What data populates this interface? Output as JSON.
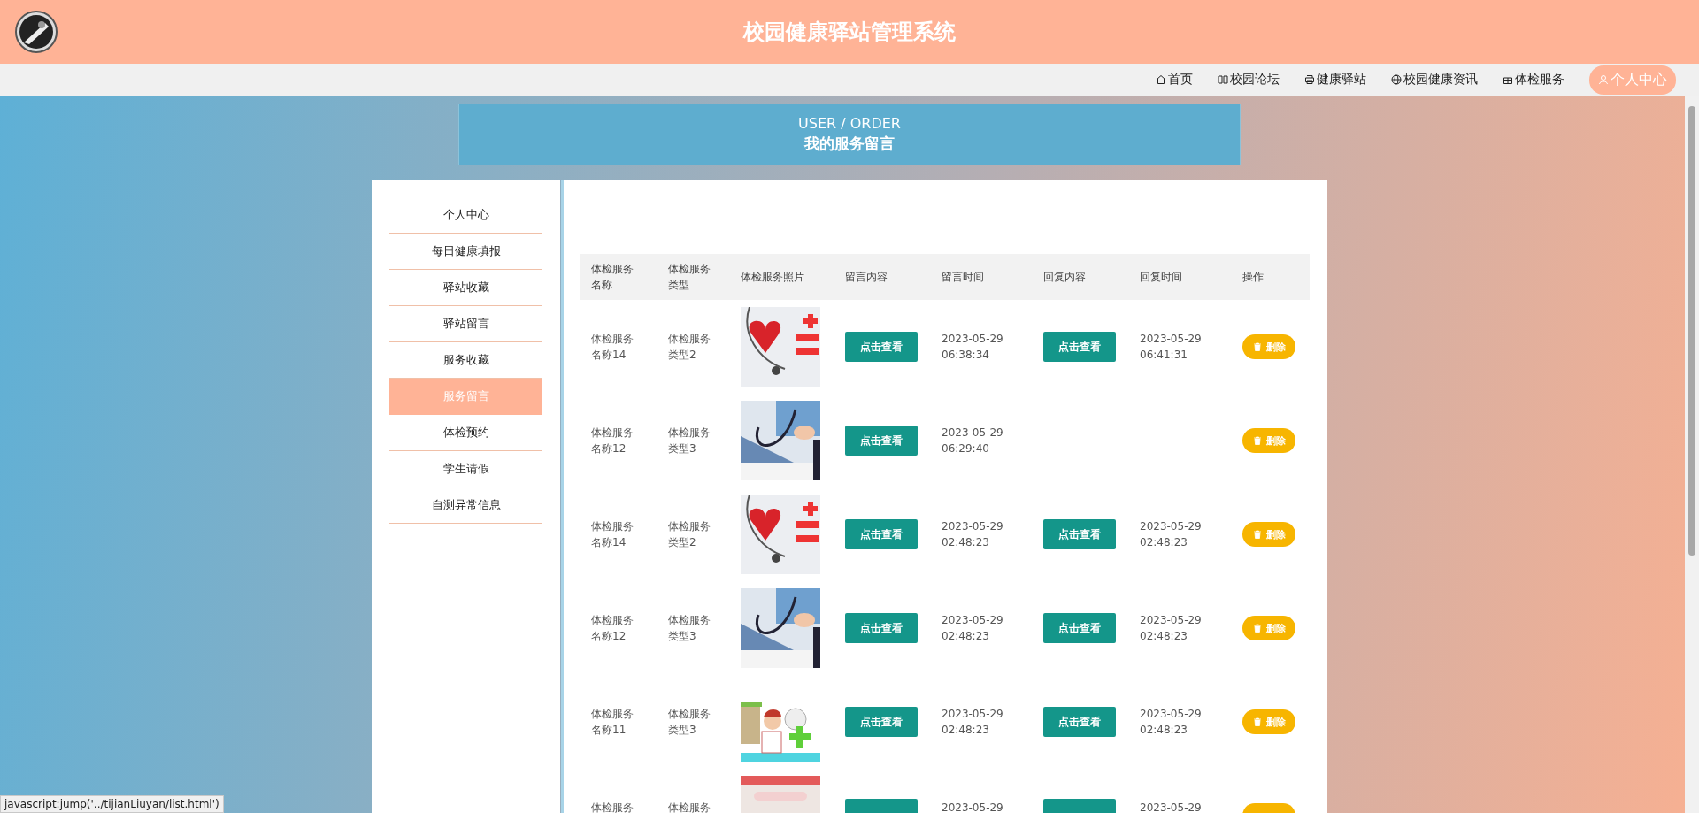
{
  "header": {
    "title": "校园健康驿站管理系统"
  },
  "nav": [
    {
      "label": "首页",
      "selected": false
    },
    {
      "label": "校园论坛",
      "selected": false
    },
    {
      "label": "健康驿站",
      "selected": false
    },
    {
      "label": "校园健康资讯",
      "selected": false
    },
    {
      "label": "体检服务",
      "selected": false
    },
    {
      "label": "个人中心",
      "selected": true
    }
  ],
  "banner": {
    "subtitle": "USER / ORDER",
    "title": "我的服务留言"
  },
  "sidebar": {
    "items": [
      {
        "label": "个人中心",
        "selected": false
      },
      {
        "label": "每日健康填报",
        "selected": false
      },
      {
        "label": "驿站收藏",
        "selected": false
      },
      {
        "label": "驿站留言",
        "selected": false
      },
      {
        "label": "服务收藏",
        "selected": false
      },
      {
        "label": "服务留言",
        "selected": true
      },
      {
        "label": "体检预约",
        "selected": false
      },
      {
        "label": "学生请假",
        "selected": false
      },
      {
        "label": "自测异常信息",
        "selected": false
      }
    ]
  },
  "table": {
    "columns": [
      "体检服务名称",
      "体检服务类型",
      "体检服务照片",
      "留言内容",
      "留言时间",
      "回复内容",
      "回复时间",
      "操作"
    ],
    "rows": [
      {
        "name": "体检服务名称14",
        "type": "体检服务类型2",
        "message_button": "点击查看",
        "message_time": "2023-05-29 06:38:34",
        "reply_button": "点击查看",
        "reply_time": "2023-05-29 06:41:31",
        "delete_button": "删除"
      },
      {
        "name": "体检服务名称12",
        "type": "体检服务类型3",
        "message_button": "点击查看",
        "message_time": "2023-05-29 06:29:40",
        "delete_button": "删除"
      },
      {
        "name": "体检服务名称14",
        "type": "体检服务类型2",
        "message_button": "点击查看",
        "message_time": "2023-05-29 02:48:23",
        "reply_button": "点击查看",
        "reply_time": "2023-05-29 02:48:23",
        "delete_button": "删除"
      },
      {
        "name": "体检服务名称12",
        "type": "体检服务类型3",
        "message_button": "点击查看",
        "message_time": "2023-05-29 02:48:23",
        "reply_button": "点击查看",
        "reply_time": "2023-05-29 02:48:23",
        "delete_button": "删除"
      },
      {
        "name": "体检服务名称11",
        "type": "体检服务类型3",
        "message_button": "点击查看",
        "message_time": "2023-05-29 02:48:23",
        "reply_button": "点击查看",
        "reply_time": "2023-05-29 02:48:23",
        "delete_button": "删除"
      },
      {
        "name": "体检服务",
        "type": "体检服务",
        "message_button": "",
        "message_time": "2023-05-29",
        "reply_button": "",
        "reply_time": "2023-05-29",
        "delete_button": ""
      }
    ]
  },
  "status_tooltip": "javascript:jump('../tijianLiuyan/list.html')"
}
